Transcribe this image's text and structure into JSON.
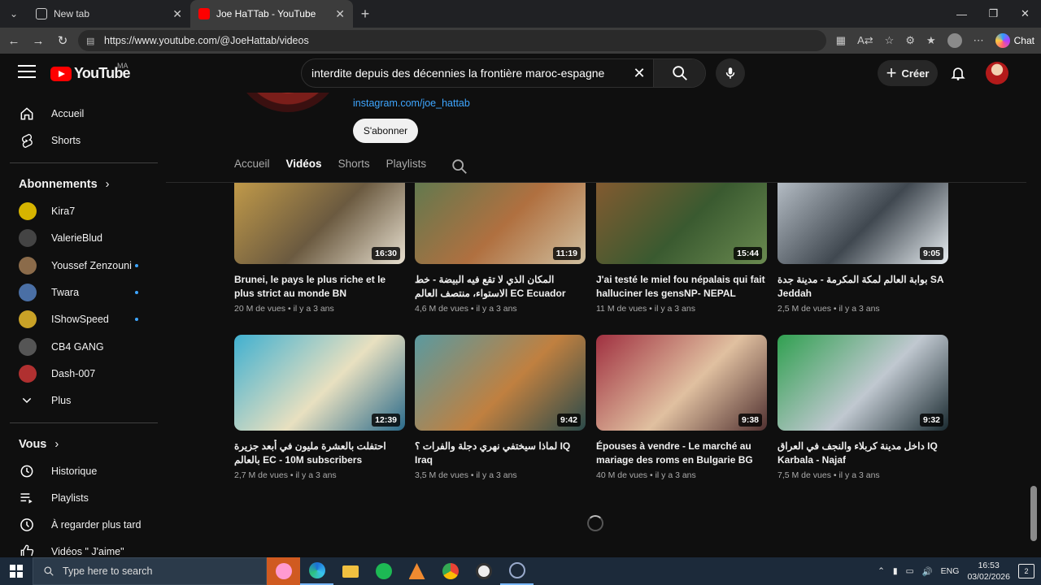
{
  "browser": {
    "tabs": [
      {
        "label": "New tab",
        "active": false
      },
      {
        "label": "Joe HaTTab - YouTube",
        "active": true
      }
    ],
    "url": "https://www.youtube.com/@JoeHattab/videos",
    "chat_label": "Chat"
  },
  "masthead": {
    "logo_text": "YouTube",
    "country_code": "MA",
    "search_query": "interdite depuis des décennies la frontière maroc-espagne",
    "create_label": "Créer"
  },
  "sidebar": {
    "main": [
      {
        "label": "Accueil",
        "icon": "home-icon"
      },
      {
        "label": "Shorts",
        "icon": "shorts-icon"
      }
    ],
    "subscriptions_title": "Abonnements",
    "subscriptions": [
      {
        "label": "Kira7",
        "color": "#d6b400",
        "live": false
      },
      {
        "label": "ValerieBlud",
        "color": "#444444",
        "live": false
      },
      {
        "label": "Youssef Zenzouni",
        "color": "#8b6b4a",
        "live": true
      },
      {
        "label": "Twara",
        "color": "#4a6fa5",
        "live": true
      },
      {
        "label": "IShowSpeed",
        "color": "#c9a227",
        "live": true
      },
      {
        "label": "CB4 GANG",
        "color": "#555555",
        "live": false
      },
      {
        "label": "Dash-007",
        "color": "#b03030",
        "live": false
      }
    ],
    "more_label": "Plus",
    "you_title": "Vous",
    "you_items": [
      {
        "label": "Historique",
        "icon": "history-icon"
      },
      {
        "label": "Playlists",
        "icon": "playlist-icon"
      },
      {
        "label": "À regarder plus tard",
        "icon": "clock-icon"
      },
      {
        "label": "Vidéos \" J'aime\"",
        "icon": "like-icon"
      }
    ]
  },
  "channel": {
    "link": "instagram.com/joe_hattab",
    "subscribe_label": "S'abonner",
    "tabs": [
      "Accueil",
      "Vidéos",
      "Shorts",
      "Playlists"
    ],
    "active_tab": "Vidéos"
  },
  "videos": [
    {
      "title": "Brunei, le pays le plus riche et le plus strict au monde BN",
      "duration": "16:30",
      "views": "20 M de vues",
      "age": "il y a 3 ans",
      "colors": [
        "#c9a04a",
        "#6b5a40",
        "#e8e0d0"
      ]
    },
    {
      "title": "المكان الذي لا تقع فيه البيضة - خط الاستواء، منتصف العالم EC Ecuador",
      "duration": "11:19",
      "views": "4,6 M de vues",
      "age": "il y a 3 ans",
      "colors": [
        "#5a7a50",
        "#b07040",
        "#d0c0a0"
      ]
    },
    {
      "title": "J'ai testé le miel fou népalais qui fait halluciner les gensNP- NEPAL",
      "duration": "15:44",
      "views": "11 M de vues",
      "age": "il y a 3 ans",
      "colors": [
        "#8a5a30",
        "#3a5a30",
        "#6a8a50"
      ]
    },
    {
      "title": "بوابة العالم لمكة المكرمة - مدينة جدة SA Jeddah",
      "duration": "9:05",
      "views": "2,5 M de vues",
      "age": "il y a 3 ans",
      "colors": [
        "#c0c8d0",
        "#404850",
        "#e8eef2"
      ]
    },
    {
      "title": "احتفلت بالعشرة مليون في أبعد جزيرة بالعالم EC - 10M subscribers",
      "duration": "12:39",
      "views": "2,7 M de vues",
      "age": "il y a 3 ans",
      "colors": [
        "#40b0d0",
        "#e8e0c0",
        "#2a6a8a"
      ]
    },
    {
      "title": "لماذا سيختفي نهري دجلة والفرات ؟ IQ Iraq",
      "duration": "9:42",
      "views": "3,5 M de vues",
      "age": "il y a 3 ans",
      "colors": [
        "#5a9aa0",
        "#c08040",
        "#2a4a4a"
      ]
    },
    {
      "title": "Épouses à vendre - Le marché au mariage des roms en Bulgarie BG",
      "duration": "9:38",
      "views": "40 M de vues",
      "age": "il y a 3 ans",
      "colors": [
        "#a03040",
        "#e0c0a0",
        "#503030"
      ]
    },
    {
      "title": "داخل مدينة كربلاء والنجف في العراق IQ Karbala - Najaf",
      "duration": "9:32",
      "views": "7,5 M de vues",
      "age": "il y a 3 ans",
      "colors": [
        "#30a050",
        "#c0c8d0",
        "#1a2a30"
      ]
    }
  ],
  "taskbar": {
    "search_placeholder": "Type here to search",
    "language": "ENG",
    "time": "16:53",
    "date": "03/02/2026",
    "notifications": "2"
  }
}
